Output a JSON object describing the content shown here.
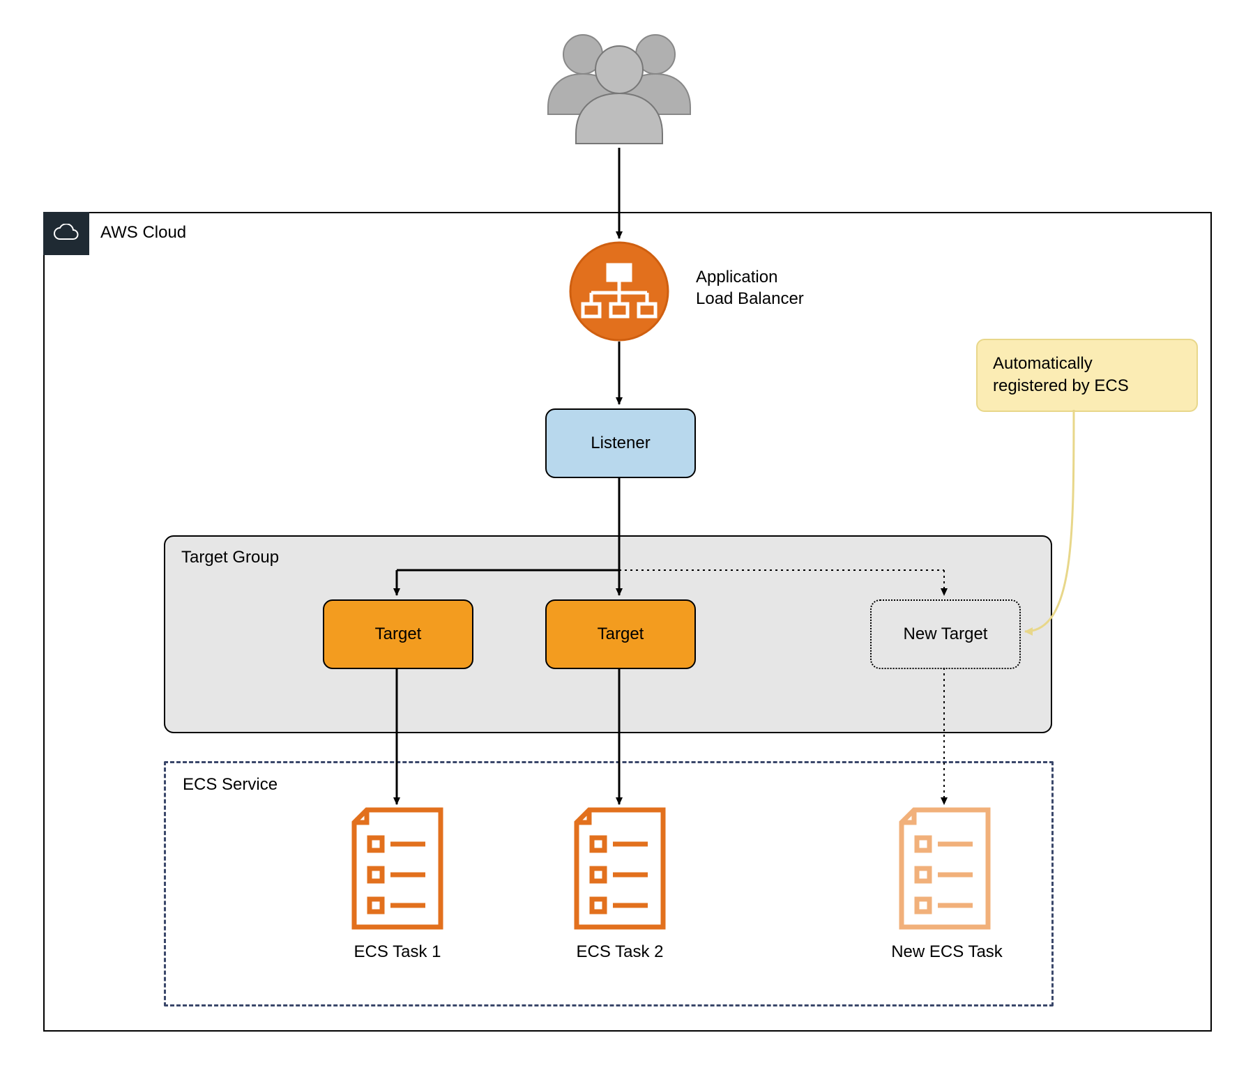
{
  "labels": {
    "aws_cloud": "AWS Cloud",
    "alb_line1": "Application",
    "alb_line2": "Load Balancer",
    "listener": "Listener",
    "target_group": "Target Group",
    "target1": "Target",
    "target2": "Target",
    "new_target": "New Target",
    "ecs_service": "ECS Service",
    "ecs_task1": "ECS Task 1",
    "ecs_task2": "ECS Task 2",
    "new_ecs_task": "New ECS Task",
    "callout_line1": "Automatically",
    "callout_line2": "registered by ECS"
  },
  "colors": {
    "orange": "#e2701d",
    "orange_light": "#f1b07a",
    "listener_fill": "#b8d8ed",
    "target_fill": "#f39c1f",
    "callout_fill": "#fbecb4",
    "callout_border": "#e8d78a",
    "group_fill": "#e6e6e6",
    "ecs_border": "#3a476a",
    "aws_tab": "#1f2a33",
    "users_gray": "#b0b0b0",
    "users_gray_dark": "#888888"
  }
}
